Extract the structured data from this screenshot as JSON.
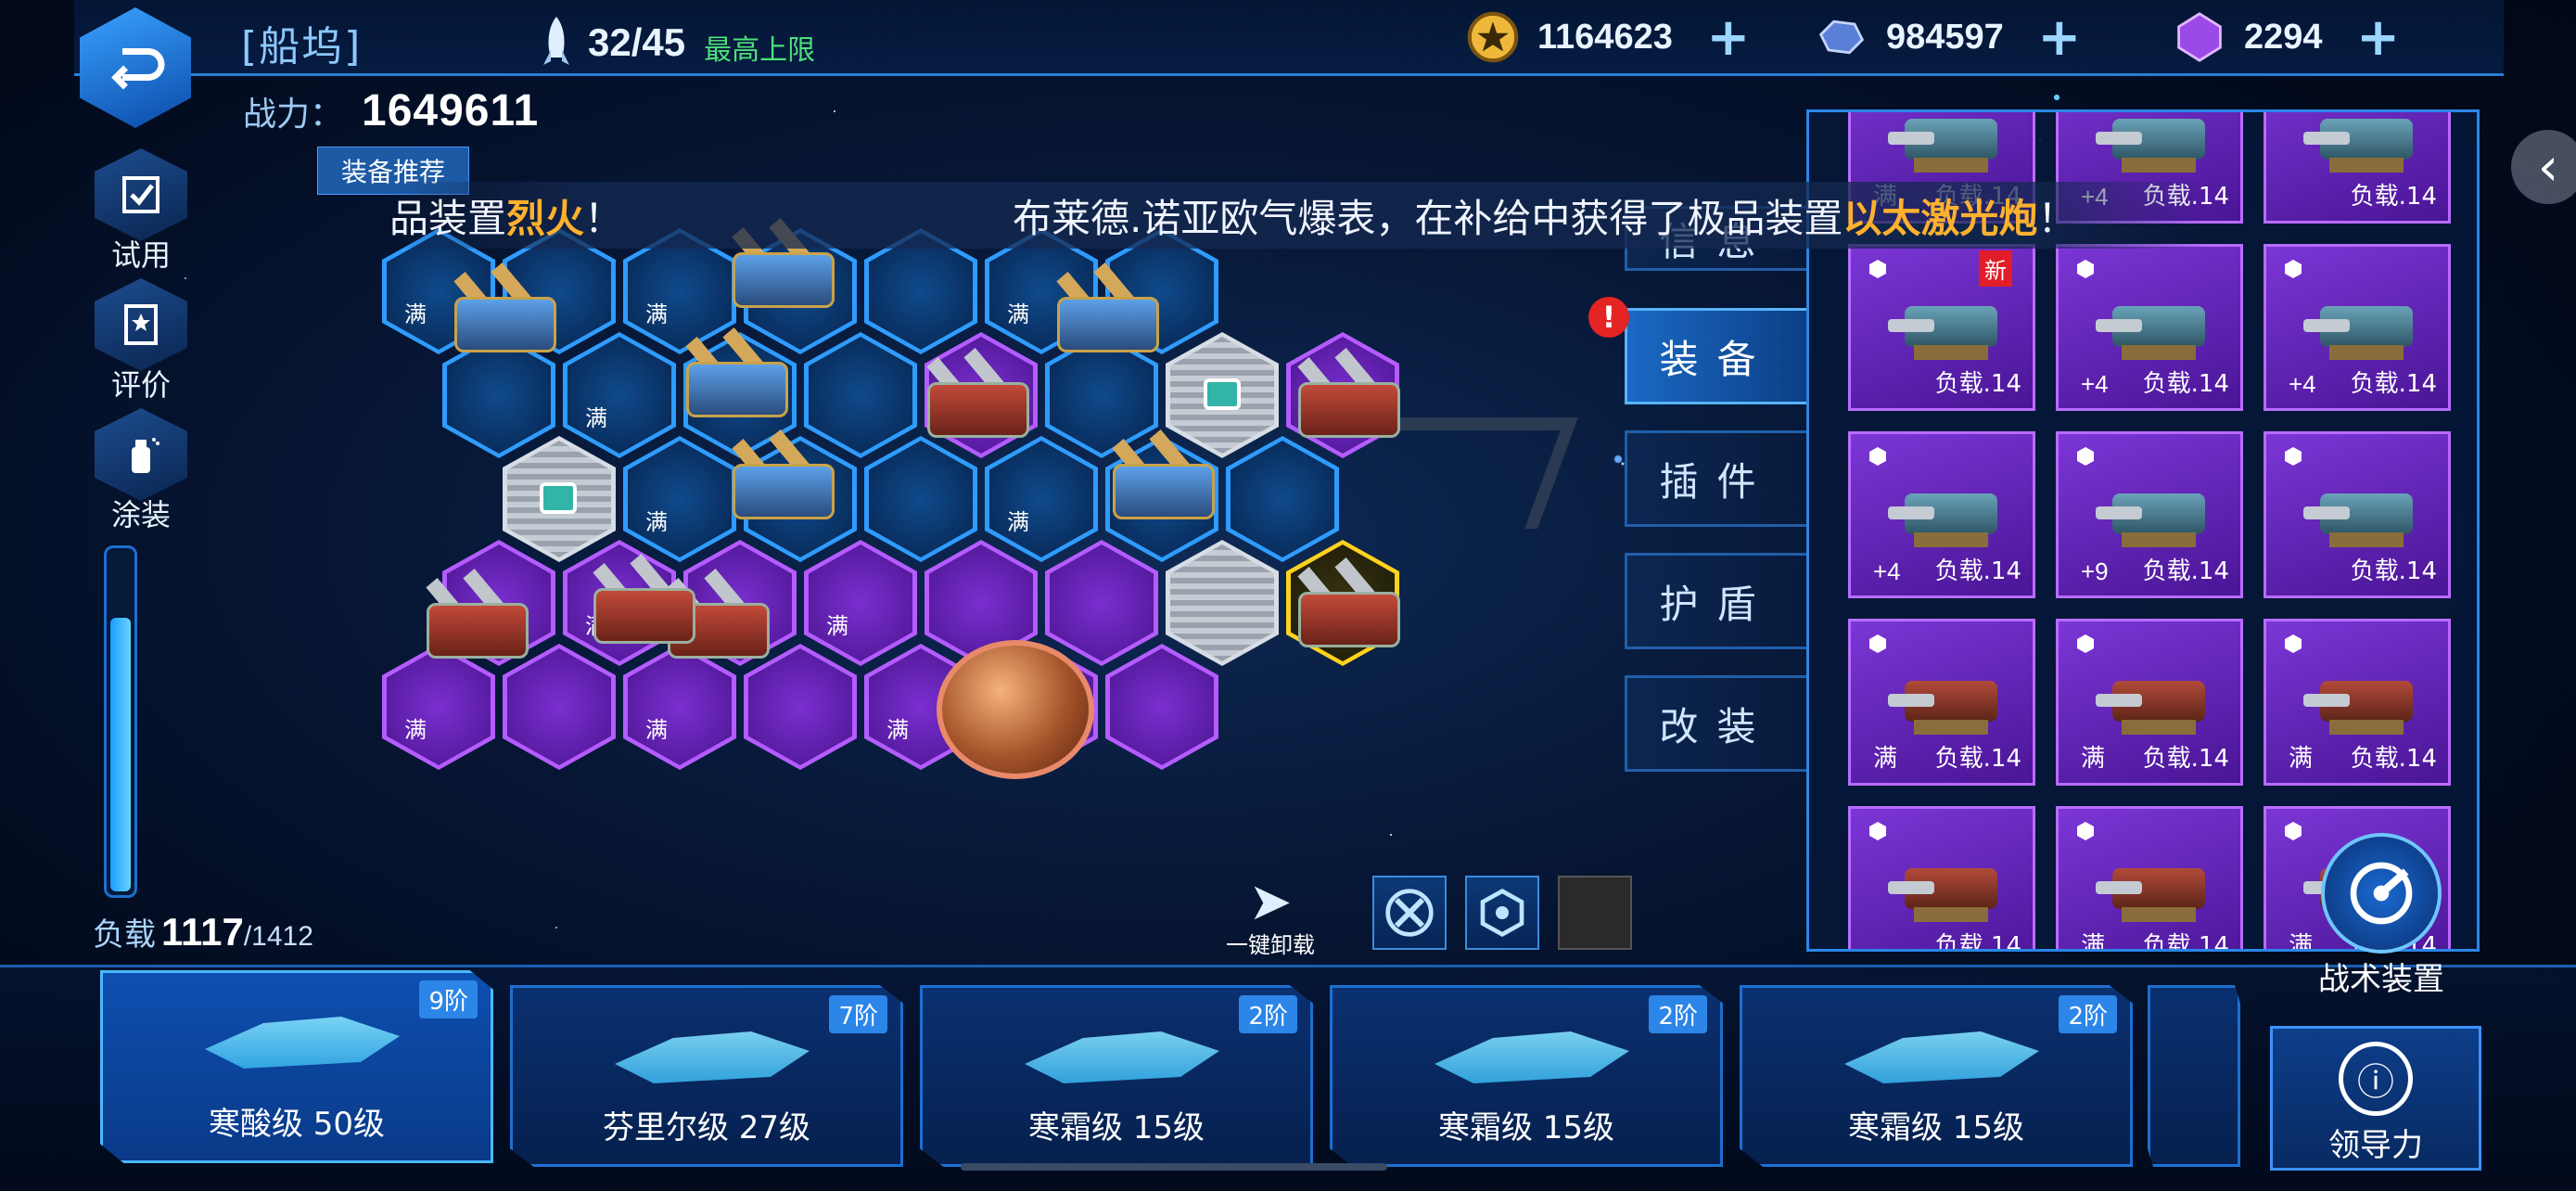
{
  "header": {
    "title": "[船坞]",
    "ships": "32/45",
    "ships_note": "最高上限",
    "gold": "1164623",
    "crystal": "984597",
    "gem": "2294",
    "plus": "+"
  },
  "power": {
    "label": "战力：",
    "value": "1649611"
  },
  "recommend_label": "装备推荐",
  "side_menu": [
    {
      "label": "试用",
      "icon": "checklist-icon"
    },
    {
      "label": "评价",
      "icon": "rating-icon"
    },
    {
      "label": "涂装",
      "icon": "spray-paint-icon"
    }
  ],
  "load": {
    "label": "负载",
    "current": "1117",
    "max": "/1412",
    "fraction": 0.79
  },
  "announcement": {
    "part1": "品装置",
    "part1_hl": "烈火",
    "part1_end": "！",
    "part2": "布莱德.诺亚欧气爆表，在补给中获得了极品装置",
    "part2_hl": "以太激光炮",
    "part2_end": "！"
  },
  "full_label": "满",
  "tabs": {
    "info": "信息",
    "equip": "装备",
    "plugin": "插件",
    "shield": "护盾",
    "modify": "改装",
    "alert": "!"
  },
  "unload_label": "一键卸载",
  "inventory": {
    "items": [
      {
        "lv": "满",
        "load": "负载.14",
        "kind": "teal"
      },
      {
        "lv": "+4",
        "load": "负载.14",
        "kind": "teal"
      },
      {
        "lv": "",
        "load": "负载.14",
        "kind": "teal"
      },
      {
        "lv": "",
        "load": "负载.14",
        "kind": "teal",
        "new": "新"
      },
      {
        "lv": "+4",
        "load": "负载.14",
        "kind": "teal"
      },
      {
        "lv": "+4",
        "load": "负载.14",
        "kind": "teal"
      },
      {
        "lv": "+4",
        "load": "负载.14",
        "kind": "teal"
      },
      {
        "lv": "+9",
        "load": "负载.14",
        "kind": "teal"
      },
      {
        "lv": "",
        "load": "负载.14",
        "kind": "teal"
      },
      {
        "lv": "满",
        "load": "负载.14",
        "kind": "red"
      },
      {
        "lv": "满",
        "load": "负载.14",
        "kind": "red"
      },
      {
        "lv": "满",
        "load": "负载.14",
        "kind": "red"
      },
      {
        "lv": "",
        "load": "负载.14",
        "kind": "red"
      },
      {
        "lv": "满",
        "load": "负载.14",
        "kind": "red"
      },
      {
        "lv": "满",
        "load": "负载.14",
        "kind": "red"
      }
    ]
  },
  "tactical_label": "战术装置",
  "ship_cards": [
    {
      "tier": "9阶",
      "name": "寒酸级 50级"
    },
    {
      "tier": "7阶",
      "name": "芬里尔级 27级"
    },
    {
      "tier": "2阶",
      "name": "寒霜级 15级"
    },
    {
      "tier": "2阶",
      "name": "寒霜级 15级"
    },
    {
      "tier": "2阶",
      "name": "寒霜级 15级"
    }
  ],
  "guide_label": "领导力",
  "colors": {
    "accent": "#2a86e8",
    "purple": "#b45cff",
    "gold": "#ffd21f",
    "highlight": "#ffb12e"
  }
}
